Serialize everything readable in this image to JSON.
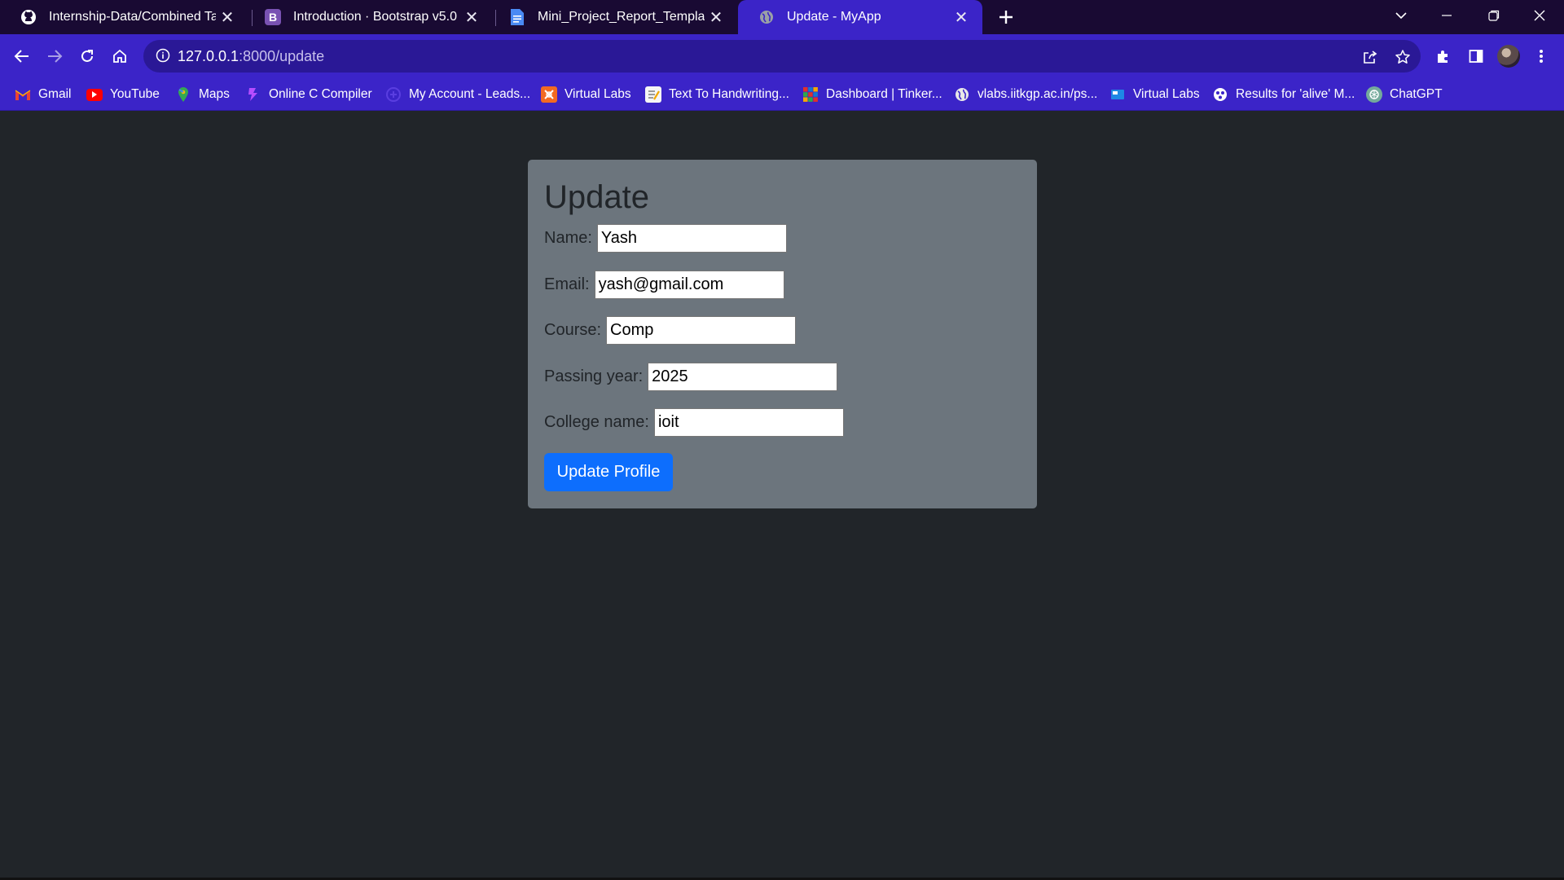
{
  "browser": {
    "tabs": [
      {
        "title": "Internship-Data/Combined Task/",
        "icon": "github-icon",
        "active": false
      },
      {
        "title": "Introduction · Bootstrap v5.0",
        "icon": "bootstrap-icon",
        "active": false
      },
      {
        "title": "Mini_Project_Report_Template - ",
        "icon": "google-docs-icon",
        "active": false
      },
      {
        "title": "Update - MyApp",
        "icon": "globe-icon",
        "active": true
      }
    ],
    "url_host": "127.0.0.1",
    "url_path": ":8000/update",
    "bookmarks": [
      {
        "label": "Gmail",
        "icon": "gmail-icon"
      },
      {
        "label": "YouTube",
        "icon": "youtube-icon"
      },
      {
        "label": "Maps",
        "icon": "maps-icon"
      },
      {
        "label": "Online C Compiler",
        "icon": "compiler-icon"
      },
      {
        "label": "My Account - Leads...",
        "icon": "leads-icon"
      },
      {
        "label": "Virtual Labs",
        "icon": "virtual-labs-icon"
      },
      {
        "label": "Text To Handwriting...",
        "icon": "handwriting-icon"
      },
      {
        "label": "Dashboard | Tinker...",
        "icon": "tinkercad-icon"
      },
      {
        "label": "vlabs.iitkgp.ac.in/ps...",
        "icon": "globe-icon"
      },
      {
        "label": "Virtual Labs",
        "icon": "virtual-labs-icon"
      },
      {
        "label": "Results for 'alive' M...",
        "icon": "results-icon"
      },
      {
        "label": "ChatGPT",
        "icon": "chatgpt-icon"
      }
    ]
  },
  "page": {
    "heading": "Update",
    "fields": [
      {
        "label": "Name:",
        "value": "Yash"
      },
      {
        "label": "Email:",
        "value": "yash@gmail.com"
      },
      {
        "label": "Course:",
        "value": "Comp"
      },
      {
        "label": "Passing year:",
        "value": "2025"
      },
      {
        "label": "College name:",
        "value": "ioit"
      }
    ],
    "submit_label": "Update Profile"
  },
  "colors": {
    "page_bg": "#212529",
    "card_bg": "#6c757d",
    "button_bg": "#0d6efd",
    "browser_accent": "#3b24c8",
    "tabstrip_bg": "#190a33"
  }
}
